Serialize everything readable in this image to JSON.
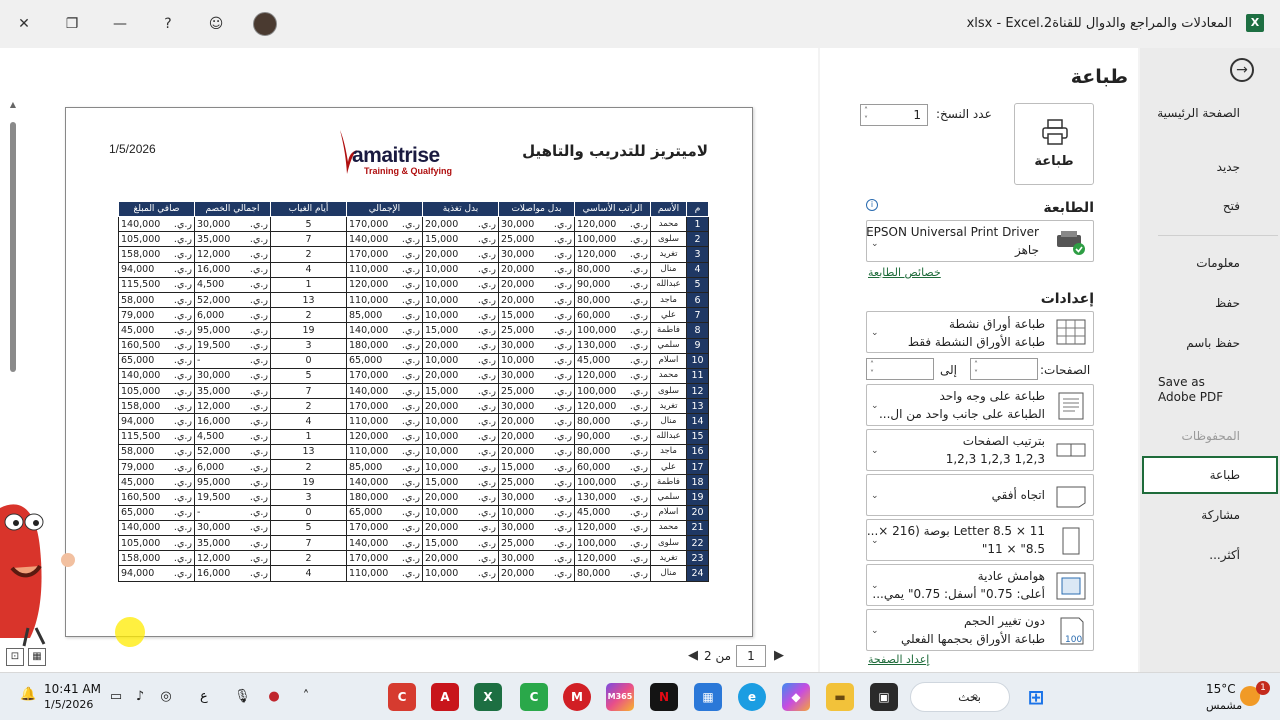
{
  "titlebar": {
    "title": "المعادلات والمراجع والدوال للقناة2.xlsx  -  Excel",
    "app_icon": "excel-icon"
  },
  "nav": {
    "home": "الصفحة الرئيسية",
    "new": "جديد",
    "open": "فتح",
    "info": "معلومات",
    "save": "حفظ",
    "save_as": "حفظ باسم",
    "save_adobe": "Save as Adobe PDF",
    "history": "المحفوظات",
    "print": "طباعة",
    "share": "مشاركة",
    "more": "أكثر..."
  },
  "settings": {
    "title": "طباعة",
    "print_button": "طباعة",
    "copies_label": "عدد النسخ:",
    "copies_value": "1",
    "printer_header": "الطابعة",
    "printer_name": "EPSON Universal Print Driver",
    "printer_status": "جاهز",
    "printer_properties": "خصائص الطابعة",
    "settings_header": "إعدادات",
    "scope_l1": "طباعة أوراق نشطة",
    "scope_l2": "طباعة الأوراق النشطة فقط",
    "pages_label": "الصفحات:",
    "pages_to": "إلى",
    "sides_l1": "طباعة على وجه واحد",
    "sides_l2": "الطباعة على جانب واحد من ال...",
    "collate_l1": "بترتيب الصفحات",
    "collate_l2": "1,2,3    1,2,3    1,2,3",
    "orientation": "اتجاه أفقي",
    "paper_l1": "Letter 8.5 × 11 بوصة (216 ×...",
    "paper_l2": "8.5\" × 11\"",
    "margins_l1": "هوامش عادية",
    "margins_l2": "أعلى: 0.75\" أسفل: 0.75\" يمي...",
    "scale_l1": "دون تغيير الحجم",
    "scale_l2": "طباعة الأوراق بحجمها الفعلي",
    "scale_icon_text": "100",
    "page_setup": "إعداد الصفحة"
  },
  "preview": {
    "date": "1/5/2026",
    "company": "لاميتريز للتدريب والتاهيل",
    "logo_word": "amaitrise",
    "logo_sub": "Training & Qualfying",
    "pager_current": "1",
    "pager_of": "من 2",
    "currency": "ر.ي."
  },
  "table": {
    "headers": [
      "م",
      "الأسم",
      "الراتب الأساسي",
      "بدل مواصلات",
      "بدل تغذية",
      "الإجمالي",
      "أيام الغياب",
      "اجمالي الخصم",
      "صافي المبلغ"
    ],
    "rows": [
      [
        "1",
        "محمد",
        "120,000",
        "30,000",
        "20,000",
        "170,000",
        "5",
        "30,000",
        "140,000"
      ],
      [
        "2",
        "سلوى",
        "100,000",
        "25,000",
        "15,000",
        "140,000",
        "7",
        "35,000",
        "105,000"
      ],
      [
        "3",
        "تغريد",
        "120,000",
        "30,000",
        "20,000",
        "170,000",
        "2",
        "12,000",
        "158,000"
      ],
      [
        "4",
        "منال",
        "80,000",
        "20,000",
        "10,000",
        "110,000",
        "4",
        "16,000",
        "94,000"
      ],
      [
        "5",
        "عبدالله",
        "90,000",
        "20,000",
        "10,000",
        "120,000",
        "1",
        "4,500",
        "115,500"
      ],
      [
        "6",
        "ماجد",
        "80,000",
        "20,000",
        "10,000",
        "110,000",
        "13",
        "52,000",
        "58,000"
      ],
      [
        "7",
        "علي",
        "60,000",
        "15,000",
        "10,000",
        "85,000",
        "2",
        "6,000",
        "79,000"
      ],
      [
        "8",
        "فاطمة",
        "100,000",
        "25,000",
        "15,000",
        "140,000",
        "19",
        "95,000",
        "45,000"
      ],
      [
        "9",
        "سلمي",
        "130,000",
        "30,000",
        "20,000",
        "180,000",
        "3",
        "19,500",
        "160,500"
      ],
      [
        "10",
        "اسلام",
        "45,000",
        "10,000",
        "10,000",
        "65,000",
        "0",
        "-",
        "65,000"
      ],
      [
        "11",
        "محمد",
        "120,000",
        "30,000",
        "20,000",
        "170,000",
        "5",
        "30,000",
        "140,000"
      ],
      [
        "12",
        "سلوى",
        "100,000",
        "25,000",
        "15,000",
        "140,000",
        "7",
        "35,000",
        "105,000"
      ],
      [
        "13",
        "تغريد",
        "120,000",
        "30,000",
        "20,000",
        "170,000",
        "2",
        "12,000",
        "158,000"
      ],
      [
        "14",
        "منال",
        "80,000",
        "20,000",
        "10,000",
        "110,000",
        "4",
        "16,000",
        "94,000"
      ],
      [
        "15",
        "عبدالله",
        "90,000",
        "20,000",
        "10,000",
        "120,000",
        "1",
        "4,500",
        "115,500"
      ],
      [
        "16",
        "ماجد",
        "80,000",
        "20,000",
        "10,000",
        "110,000",
        "13",
        "52,000",
        "58,000"
      ],
      [
        "17",
        "علي",
        "60,000",
        "15,000",
        "10,000",
        "85,000",
        "2",
        "6,000",
        "79,000"
      ],
      [
        "18",
        "فاطمة",
        "100,000",
        "25,000",
        "15,000",
        "140,000",
        "19",
        "95,000",
        "45,000"
      ],
      [
        "19",
        "سلمي",
        "130,000",
        "30,000",
        "20,000",
        "180,000",
        "3",
        "19,500",
        "160,500"
      ],
      [
        "20",
        "اسلام",
        "45,000",
        "10,000",
        "10,000",
        "65,000",
        "0",
        "-",
        "65,000"
      ],
      [
        "21",
        "محمد",
        "120,000",
        "30,000",
        "20,000",
        "170,000",
        "5",
        "30,000",
        "140,000"
      ],
      [
        "22",
        "سلوى",
        "100,000",
        "25,000",
        "15,000",
        "140,000",
        "7",
        "35,000",
        "105,000"
      ],
      [
        "23",
        "تغريد",
        "120,000",
        "30,000",
        "20,000",
        "170,000",
        "2",
        "12,000",
        "158,000"
      ],
      [
        "24",
        "منال",
        "80,000",
        "20,000",
        "10,000",
        "110,000",
        "4",
        "16,000",
        "94,000"
      ]
    ]
  },
  "taskbar": {
    "time": "10:41 AM",
    "date": "1/5/2026",
    "lang": "ع",
    "search": "بحث",
    "temp": "15°C",
    "weather": "مشمس",
    "notif_count": "1",
    "m365_label": "M365"
  },
  "colors": {
    "accent": "#1e6b3a",
    "table_header": "#1f3864",
    "excel_green": "#1d6f42"
  }
}
